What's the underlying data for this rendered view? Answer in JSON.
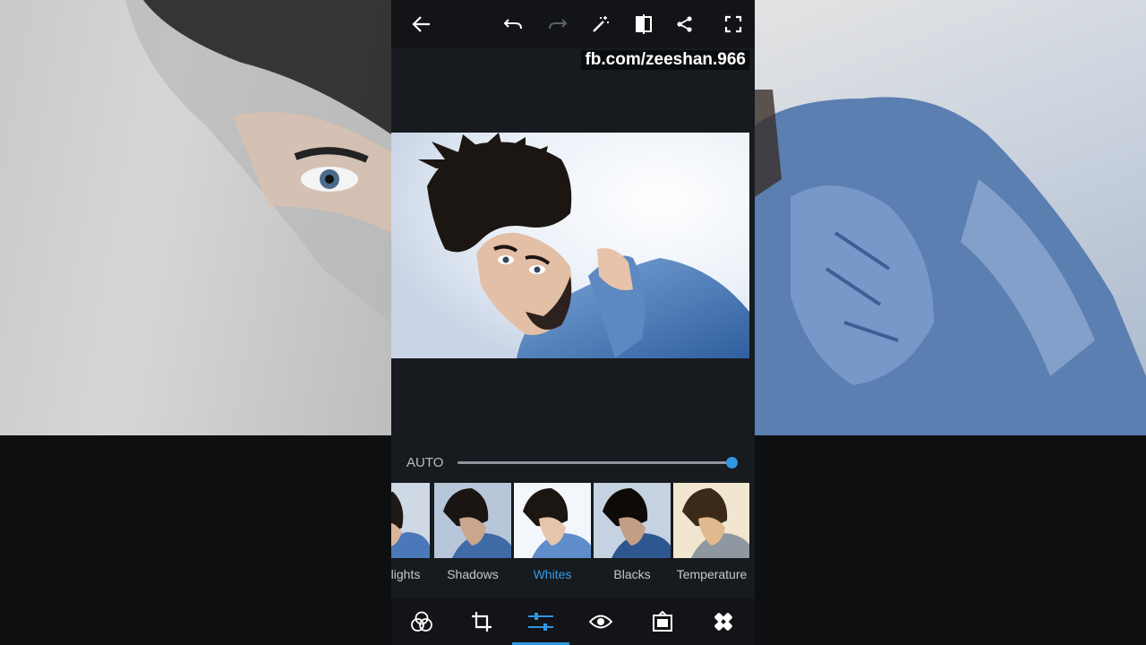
{
  "watermark": "fb.com/zeeshan.966",
  "toolbar": {
    "icons": [
      "back-arrow-icon",
      "undo-icon",
      "redo-icon",
      "magic-wand-icon",
      "compare-icon",
      "share-icon",
      "fullscreen-icon"
    ]
  },
  "adjust": {
    "auto_label": "AUTO",
    "value_fraction": 1.0
  },
  "filters": [
    {
      "label": "lights",
      "tone": "cool"
    },
    {
      "label": "Shadows",
      "tone": "cool"
    },
    {
      "label": "Whites",
      "tone": "bright",
      "active": true
    },
    {
      "label": "Blacks",
      "tone": "dark"
    },
    {
      "label": "Temperature",
      "tone": "warm"
    }
  ],
  "bottom_tabs": [
    "looks-icon",
    "crop-icon",
    "adjustments-icon",
    "eye-icon",
    "frame-icon",
    "heal-icon"
  ],
  "colors": {
    "accent": "#2f96e0",
    "panel": "#171a1e",
    "bar": "#121417"
  }
}
